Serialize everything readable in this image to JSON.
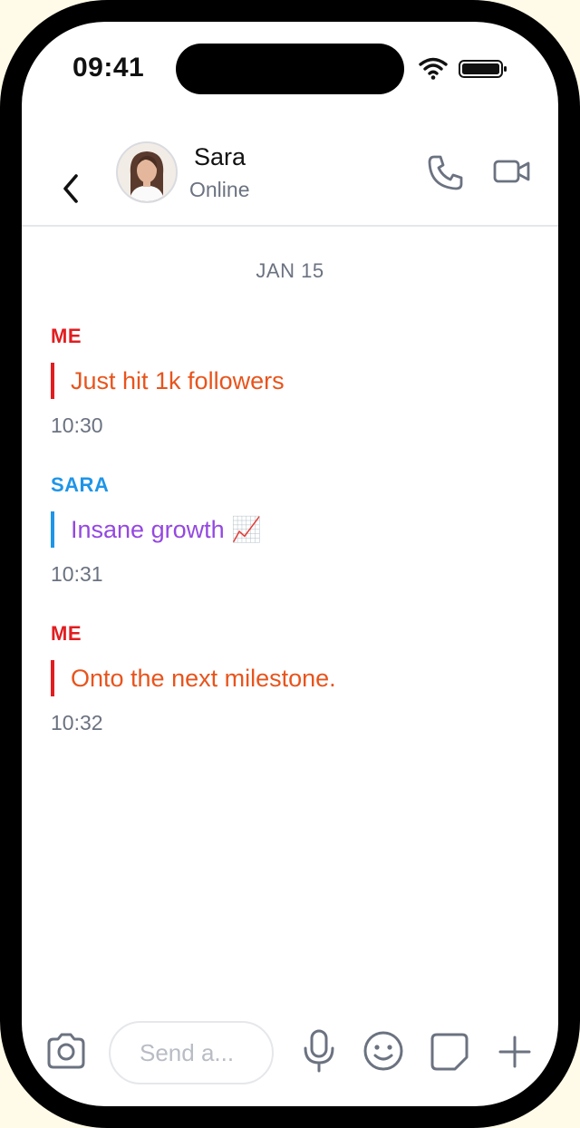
{
  "status_bar": {
    "time": "09:41",
    "icons": [
      "wifi-icon",
      "battery-icon"
    ]
  },
  "header": {
    "back_icon": "chevron-left-icon",
    "contact_name": "Sara",
    "contact_status": "Online",
    "actions": [
      "phone-icon",
      "video-camera-icon"
    ]
  },
  "conversation": {
    "date_label": "JAN 15",
    "messages": [
      {
        "sender": "ME",
        "text": "Just hit 1k followers",
        "time": "10:30"
      },
      {
        "sender": "SARA",
        "text": "Insane growth 📈",
        "time": "10:31"
      },
      {
        "sender": "ME",
        "text": "Onto the next milestone.",
        "time": "10:32"
      }
    ]
  },
  "composer": {
    "placeholder": "Send a...",
    "icons": [
      "camera-icon",
      "microphone-icon",
      "smiley-icon",
      "sticker-icon",
      "plus-icon"
    ]
  },
  "colors": {
    "me_label": "#e11d20",
    "me_text": "#e8541c",
    "sara_label": "#1e95e8",
    "sara_text": "#9448e0",
    "icon_gray": "#6b7280"
  }
}
